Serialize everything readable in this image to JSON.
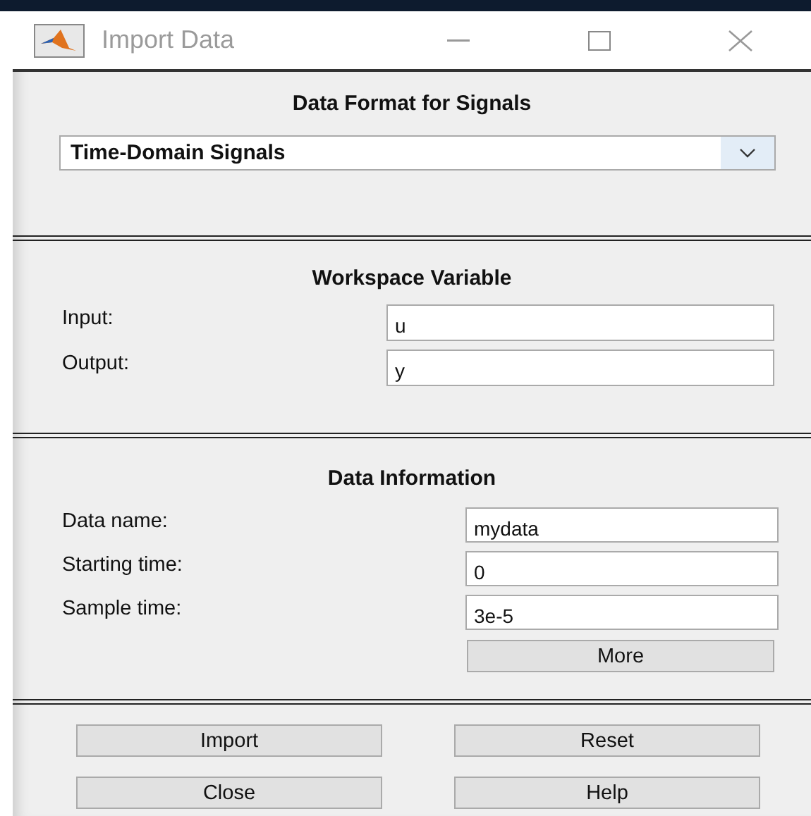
{
  "window": {
    "title": "Import Data"
  },
  "format_section": {
    "title": "Data Format for Signals",
    "dropdown": {
      "value": "Time-Domain Signals"
    }
  },
  "workspace_section": {
    "title": "Workspace Variable",
    "fields": [
      {
        "label": "Input:",
        "value": "u"
      },
      {
        "label": "Output:",
        "value": "y"
      }
    ]
  },
  "info_section": {
    "title": "Data Information",
    "fields": [
      {
        "label": "Data name:",
        "value": "mydata"
      },
      {
        "label": "Starting time:",
        "value": "0"
      },
      {
        "label": "Sample time:",
        "value": "3e-5"
      }
    ],
    "more_button": "More"
  },
  "buttons": [
    {
      "label": "Import"
    },
    {
      "label": "Reset"
    },
    {
      "label": "Close"
    },
    {
      "label": "Help"
    }
  ]
}
